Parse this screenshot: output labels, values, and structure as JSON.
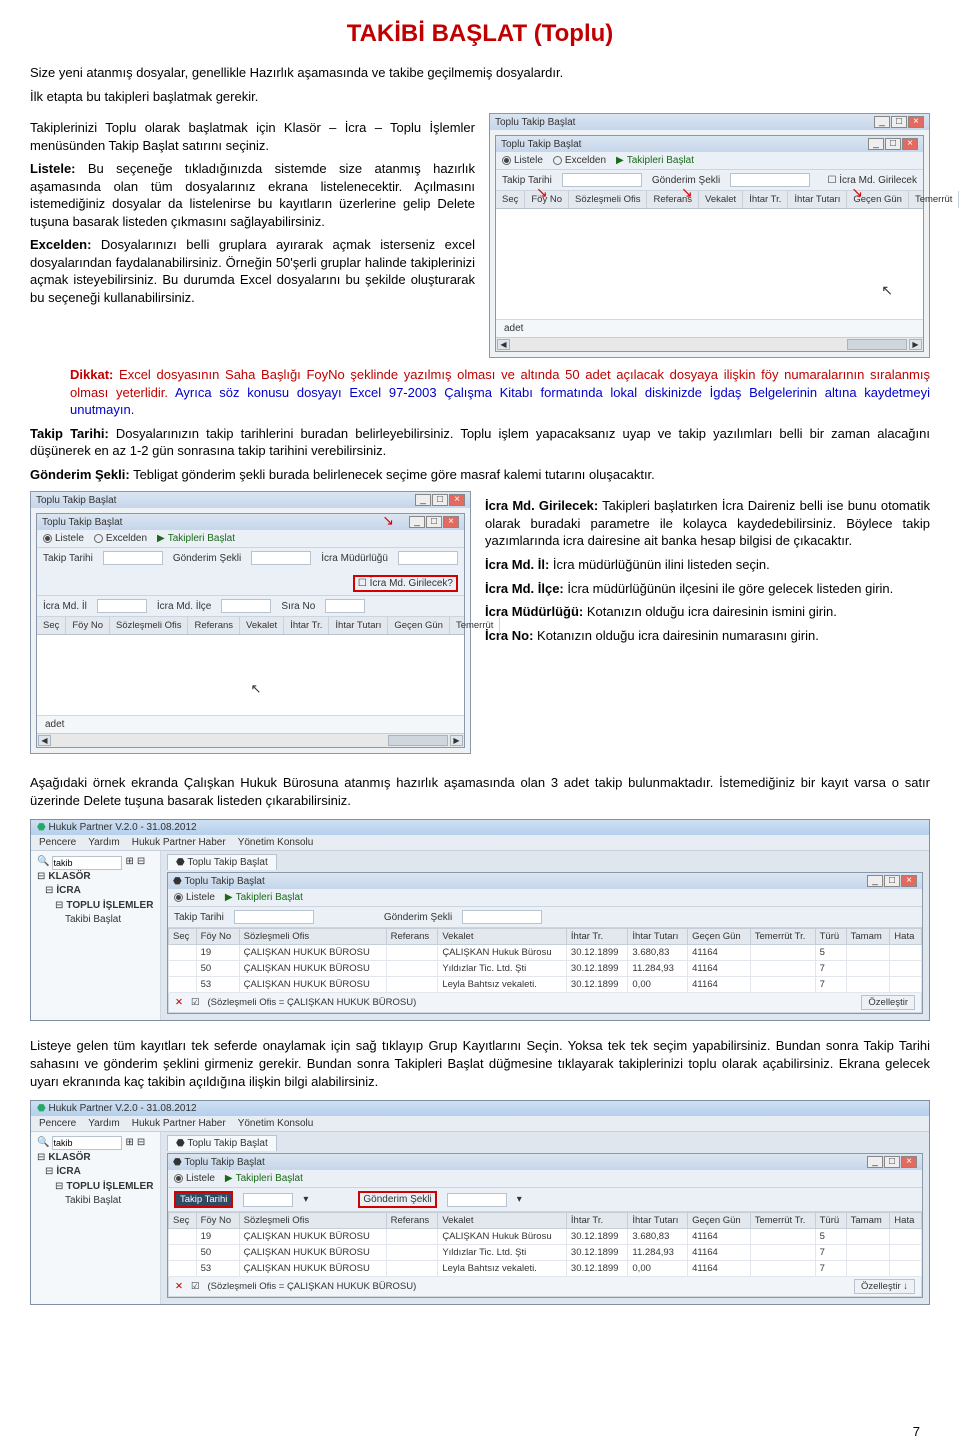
{
  "page": {
    "number": "7"
  },
  "h1": "TAKİBİ BAŞLAT (Toplu)",
  "intro": [
    "Size yeni atanmış dosyalar, genellikle Hazırlık aşamasında ve takibe geçilmemiş dosyalardır.",
    "İlk etapta bu takipleri başlatmak gerekir.",
    "Takiplerinizi Toplu olarak başlatmak için Klasör – İcra – Toplu İşlemler menüsünden Takip Başlat satırını seçiniz."
  ],
  "listele": {
    "label": "Listele:",
    "text": " Bu seçeneğe tıkladığınızda sistemde size atanmış hazırlık aşamasında olan tüm dosyalarınız ekrana listelenecektir. Açılmasını istemediğiniz dosyalar da listelenirse bu kayıtların üzerlerine gelip Delete tuşuna basarak listeden çıkmasını sağlayabilirsiniz."
  },
  "excelden": {
    "label": "Excelden:",
    "text": " Dosyalarınızı belli gruplara ayırarak açmak isterseniz excel dosyalarından faydalanabilirsiniz. Örneğin 50'şerli gruplar halinde takiplerinizi açmak isteyebilirsiniz. Bu durumda Excel dosyalarını bu şekilde oluşturarak bu seçeneği kullanabilirsiniz."
  },
  "dikkat": {
    "label": "Dikkat:",
    "part1": " Excel dosyasının Saha Başlığı FoyNo şeklinde yazılmış olması ve altında 50 adet açılacak dosyaya ilişkin föy numaralarının sıralanmış olması yeterlidir. ",
    "part2": "Ayrıca söz konusu dosyayı Excel 97-2003 Çalışma Kitabı formatında lokal diskinizde İgdaş Belgelerinin altına kaydetmeyi unutmayın."
  },
  "takiptarihi": {
    "label": "Takip Tarihi:",
    "text": " Dosyalarınızın takip tarihlerini buradan belirleyebilirsiniz. Toplu işlem yapacaksanız uyap ve takip yazılımları belli bir zaman alacağını düşünerek en az 1-2 gün sonrasına takip tarihini verebilirsiniz."
  },
  "gonderim": {
    "label": "Gönderim Şekli:",
    "text": " Tebligat gönderim şekli burada belirlenecek seçime göre masraf kalemi tutarını oluşacaktır."
  },
  "icramd": {
    "g_label": "İcra Md. Girilecek:",
    "g_text": " Takipleri başlatırken İcra Daireniz belli ise bunu otomatik olarak buradaki parametre ile kolayca kaydedebilirsiniz. Böylece takip yazımlarında icra dairesine ait banka hesap bilgisi de çıkacaktır.",
    "il_label": "İcra Md. İl:",
    "il_text": " İcra müdürlüğünün ilini listeden seçin.",
    "ilce_label": "İcra Md. İlçe:",
    "ilce_text": " İcra müdürlüğünün ilçesini ile göre gelecek listeden girin.",
    "mud_label": "İcra Müdürlüğü:",
    "mud_text": " Kotanızın olduğu icra dairesinin ismini girin.",
    "no_label": "İcra No:",
    "no_text": " Kotanızın olduğu icra dairesinin numarasını girin."
  },
  "ornek_before": "Aşağıdaki örnek ekranda Çalışkan Hukuk Bürosuna atanmış hazırlık aşamasında olan 3 adet takip bulunmaktadır. İstemediğiniz bir kayıt varsa o satır üzerinde Delete tuşuna basarak listeden çıkarabilirsiniz.",
  "final": "Listeye gelen tüm kayıtları tek seferde onaylamak için sağ tıklayıp Grup Kayıtlarını Seçin. Yoksa tek tek seçim yapabilirsiniz. Bundan sonra Takip Tarihi sahasını ve gönderim şeklini girmeniz gerekir. Bundan sonra Takipleri Başlat düğmesine tıklayarak takiplerinizi toplu olarak açabilirsiniz. Ekrana gelecek uyarı ekranında kaç takibin açıldığına ilişkin bilgi alabilirsiniz.",
  "win1": {
    "title": "Toplu Takip Başlat",
    "inner_title": "Toplu Takip Başlat",
    "listele": "Listele",
    "excelden": "Excelden",
    "takipleri_baslat": "Takipleri Başlat",
    "row2_takip_tarihi": "Takip Tarihi",
    "row2_gonderim": "Gönderim Şekli",
    "row2_icramd": "İcra Md. Girilecek",
    "cols": [
      "Seç",
      "Föy No",
      "Sözleşmeli Ofis",
      "Referans",
      "Vekalet",
      "İhtar Tr.",
      "İhtar Tutarı",
      "Geçen Gün",
      "Temerrüt"
    ],
    "status": "adet"
  },
  "win2": {
    "title": "Toplu Takip Başlat",
    "inner_title": "Toplu Takip Başlat",
    "listele": "Listele",
    "excelden": "Excelden",
    "takipleri_baslat": "Takipleri Başlat",
    "row_takip_tarihi": "Takip Tarihi",
    "row_gonderim": "Gönderim Şekli",
    "row_icramud": "İcra Müdürlüğü",
    "row_icramd_g": "İcra Md. Girilecek?",
    "row_icramd_il": "İcra Md. İl",
    "row_icramd_ilce": "İcra Md. İlçe",
    "row_sirano": "Sıra No",
    "cols": [
      "Seç",
      "Föy No",
      "Sözleşmeli Ofis",
      "Referans",
      "Vekalet",
      "İhtar Tr.",
      "İhtar Tutarı",
      "Geçen Gün",
      "Temerrüt"
    ],
    "status": "adet"
  },
  "app": {
    "title": "Hukuk Partner V.2.0 - 31.08.2012",
    "menu": [
      "Pencere",
      "Yardım",
      "Hukuk Partner Haber",
      "Yönetim Konsolu"
    ],
    "search": "takib",
    "tree": {
      "klasor": "KLASÖR",
      "icra": "İCRA",
      "toplu": "TOPLU İŞLEMLER",
      "takibi": "Takibi Başlat"
    },
    "tab": "Toplu Takip Başlat",
    "panel_title": "Toplu Takip Başlat",
    "listele": "Listele",
    "takipleri_baslat": "Takipleri Başlat",
    "f_takip_tarihi": "Takip Tarihi",
    "f_gonderim": "Gönderim Şekli",
    "cols": [
      "Seç",
      "Föy No",
      "Sözleşmeli Ofis",
      "Referans",
      "Vekalet",
      "İhtar Tr.",
      "İhtar Tutarı",
      "Geçen Gün",
      "Temerrüt Tr.",
      "Türü",
      "Tamam",
      "Hata"
    ],
    "filter_text": "(Sözleşmeli Ofis = ÇALIŞKAN HUKUK BÜROSU)",
    "ozellestir": "Özelleştir",
    "ozellestir2": "Özelleştir ↓"
  },
  "chart_data": {
    "type": "table",
    "columns": [
      "Seç",
      "Föy No",
      "Sözleşmeli Ofis",
      "Referans",
      "Vekalet",
      "İhtar Tr.",
      "İhtar Tutarı",
      "Geçen Gün",
      "Temerrüt Tr.",
      "Türü",
      "Tamam",
      "Hata"
    ],
    "rows": [
      {
        "Seç": "",
        "Föy No": "19",
        "Sözleşmeli Ofis": "ÇALIŞKAN HUKUK BÜROSU",
        "Referans": "",
        "Vekalet": "ÇALIŞKAN Hukuk Bürosu",
        "İhtar Tr.": "30.12.1899",
        "İhtar Tutarı": "3.680,83",
        "Geçen Gün": "41164",
        "Türü": "5"
      },
      {
        "Seç": "",
        "Föy No": "50",
        "Sözleşmeli Ofis": "ÇALIŞKAN HUKUK BÜROSU",
        "Referans": "",
        "Vekalet": "Yıldızlar Tic. Ltd. Şti",
        "İhtar Tr.": "30.12.1899",
        "İhtar Tutarı": "11.284,93",
        "Geçen Gün": "41164",
        "Türü": "7"
      },
      {
        "Seç": "",
        "Föy No": "53",
        "Sözleşmeli Ofis": "ÇALIŞKAN HUKUK BÜROSU",
        "Referans": "",
        "Vekalet": "Leyla Bahtsız vekaleti.",
        "İhtar Tr.": "30.12.1899",
        "İhtar Tutarı": "0,00",
        "Geçen Gün": "41164",
        "Türü": "7"
      }
    ]
  },
  "chart_data_2": {
    "type": "table",
    "columns": [
      "Seç",
      "Föy No",
      "Sözleşmeli Ofis",
      "Referans",
      "Vekalet",
      "İhtar Tr.",
      "İhtar Tutarı",
      "Geçen Gün",
      "Temerrüt Tr.",
      "Türü",
      "Tamam",
      "Hata"
    ],
    "rows": [
      {
        "Föy No": "19",
        "Sözleşmeli Ofis": "ÇALIŞKAN HUKUK BÜROSU",
        "Vekalet": "ÇALIŞKAN Hukuk Bürosu",
        "İhtar Tr.": "30.12.1899",
        "İhtar Tutarı": "3.680,83",
        "Geçen Gün": "41164",
        "Türü": "5"
      },
      {
        "Föy No": "50",
        "Sözleşmeli Ofis": "ÇALIŞKAN HUKUK BÜROSU",
        "Vekalet": "Yıldızlar Tic. Ltd. Şti",
        "İhtar Tr.": "30.12.1899",
        "İhtar Tutarı": "11.284,93",
        "Geçen Gün": "41164",
        "Türü": "7"
      },
      {
        "Föy No": "53",
        "Sözleşmeli Ofis": "ÇALIŞKAN HUKUK BÜROSU",
        "Vekalet": "Leyla Bahtsız vekaleti.",
        "İhtar Tr.": "30.12.1899",
        "İhtar Tutarı": "0,00",
        "Geçen Gün": "41164",
        "Türü": "7"
      }
    ]
  }
}
